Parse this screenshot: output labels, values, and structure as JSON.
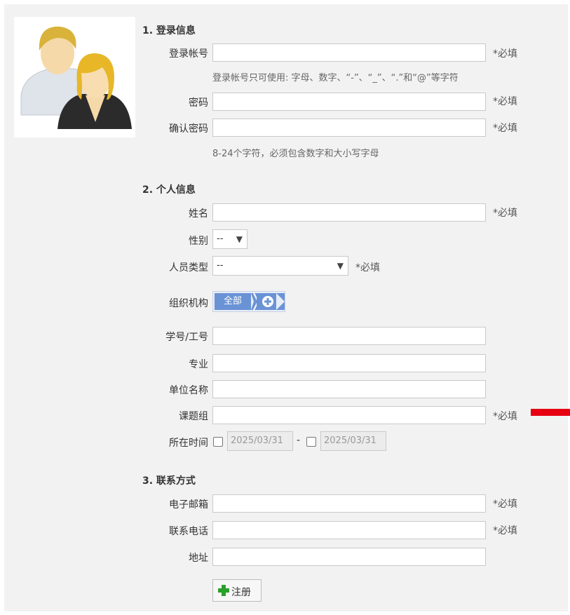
{
  "form": {
    "sections": {
      "login": "1. 登录信息",
      "personal": "2. 个人信息",
      "contact": "3. 联系方式"
    },
    "labels": {
      "account": "登录帐号",
      "password": "密码",
      "confirm_password": "确认密码",
      "name": "姓名",
      "gender": "性别",
      "person_type": "人员类型",
      "organization": "组织机构",
      "student_id": "学号/工号",
      "major": "专业",
      "unit_name": "单位名称",
      "research_group": "课题组",
      "duration": "所在时间",
      "email": "电子邮箱",
      "phone": "联系电话",
      "address": "地址"
    },
    "required_text": "*必填",
    "hints": {
      "account": "登录帐号只可使用: 字母、数字、“-”、“_”、“.”和“@”等字符",
      "password": "8-24个字符，必须包含数字和大小写字母"
    },
    "values": {
      "account": "",
      "password": "",
      "confirm_password": "",
      "name": "",
      "student_id": "",
      "major": "",
      "unit_name": "",
      "research_group": "",
      "email": "",
      "phone": "",
      "address": ""
    },
    "gender_selected": "--",
    "person_type_selected": "--",
    "organization_tag": "全部",
    "date_start": "2025/03/31",
    "date_end": "2025/03/31",
    "date_separator": "-",
    "submit_label": "注册"
  },
  "icons": {
    "avatar": "users-avatar-icon",
    "organization_add": "plus-circle-icon",
    "submit": "green-plus-icon"
  },
  "colors": {
    "panel_bg": "#f2f2f2",
    "org_tag_bg": "#6a93d6",
    "submit_plus": "#2aa12a",
    "red_marker": "#e60012"
  }
}
